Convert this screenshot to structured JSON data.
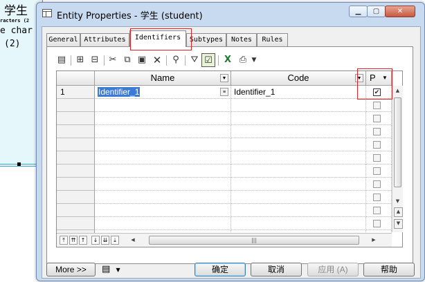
{
  "background": {
    "entity_title": "学生",
    "line_attributes": "racters (2",
    "line_type": "e char",
    "line_length": "(2)"
  },
  "window": {
    "title": "Entity Properties - 学生 (student)",
    "minimize_icon": "minimize-icon",
    "maximize_icon": "maximize-icon",
    "close_icon": "close-icon"
  },
  "tabs": [
    {
      "label": "General"
    },
    {
      "label": "Attributes"
    },
    {
      "label": "Identifiers"
    },
    {
      "label": "Subtypes"
    },
    {
      "label": "Notes"
    },
    {
      "label": "Rules"
    }
  ],
  "active_tab": "Identifiers",
  "toolbar": {
    "icons": [
      "properties-icon",
      "insert-row-icon",
      "add-row-icon",
      "cut-icon",
      "copy-icon",
      "paste-icon",
      "delete-icon",
      "find-icon",
      "filter-icon",
      "customize-columns-icon",
      "excel-export-icon",
      "print-icon",
      "dropdown-arrow-icon"
    ]
  },
  "grid": {
    "columns": [
      {
        "label": "Name"
      },
      {
        "label": "Code"
      },
      {
        "label": "P"
      }
    ],
    "rows": [
      {
        "num": "1",
        "name": "Identifier_1",
        "code": "Identifier_1",
        "primary": true
      }
    ],
    "empty_rows": 11
  },
  "nav_buttons": [
    "first-icon",
    "page-up-icon",
    "up-icon",
    "down-icon",
    "page-down-icon",
    "last-icon"
  ],
  "footer": {
    "more_label": "More >>",
    "ok_label": "确定",
    "cancel_label": "取消",
    "apply_label": "应用 (A)",
    "help_label": "帮助"
  }
}
